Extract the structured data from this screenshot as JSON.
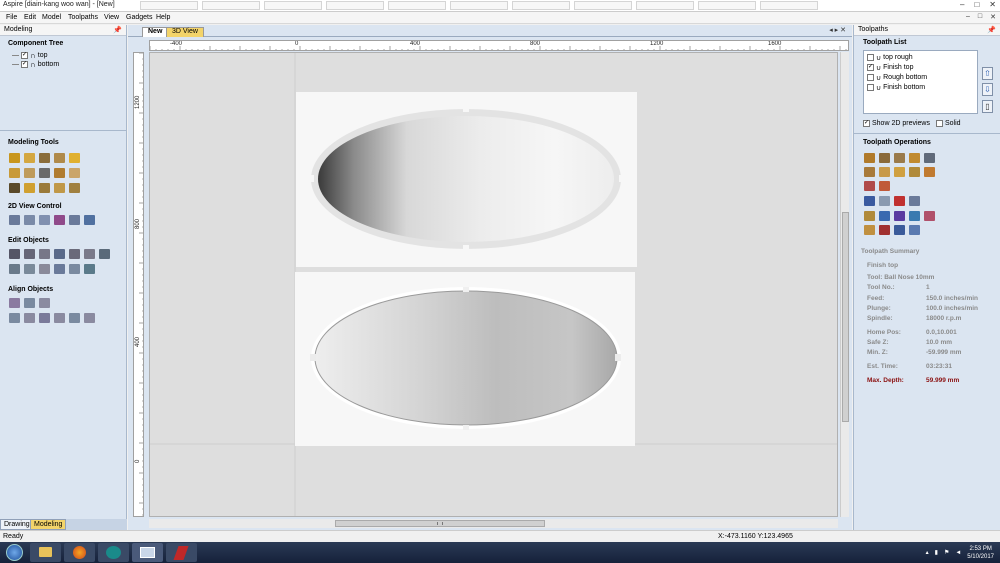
{
  "window": {
    "title": "Aspire [diain-kang woo wan] - [New]",
    "controls": [
      "–",
      "□",
      "✕"
    ]
  },
  "menu": {
    "items": [
      "File",
      "Edit",
      "Model",
      "Toolpaths",
      "View",
      "Gadgets",
      "Help"
    ],
    "mdi_controls": [
      "–",
      "□",
      "✕"
    ]
  },
  "left_panel": {
    "header": "Modeling",
    "pin": "📌",
    "component_tree_title": "Component Tree",
    "components": [
      {
        "label": "top",
        "checked": true
      },
      {
        "label": "bottom",
        "checked": true
      }
    ],
    "sections": {
      "modeling_tools": "Modeling Tools",
      "view_control": "2D View Control",
      "edit_objects": "Edit Objects",
      "align_objects": "Align Objects"
    },
    "bottom_tabs": [
      "Drawing",
      "Modeling"
    ]
  },
  "view_tabs": {
    "tabs": [
      "New",
      "3D View"
    ],
    "controls": "◂ ▸ ✕"
  },
  "rulers": {
    "horizontal": [
      "-400",
      "0",
      "400",
      "800",
      "1200",
      "1600"
    ],
    "vertical": [
      "1200",
      "800",
      "400",
      "0"
    ]
  },
  "right_panel": {
    "header": "Toolpaths",
    "pin": "📌",
    "list_title": "Toolpath List",
    "toolpaths": [
      {
        "label": "top rough",
        "checked": false
      },
      {
        "label": "Finish top",
        "checked": true
      },
      {
        "label": "Rough bottom",
        "checked": false
      },
      {
        "label": "Finish bottom",
        "checked": false
      }
    ],
    "show_2d_previews": {
      "label": "Show 2D previews",
      "checked": true
    },
    "solid": {
      "label": "Solid",
      "checked": false
    },
    "operations_title": "Toolpath Operations",
    "summary": {
      "title": "Toolpath Summary",
      "name": "Finish top",
      "tool": "Tool: Ball Nose 10mm",
      "rows": [
        {
          "label": "Tool No.:",
          "value": "1"
        },
        {
          "label": "Feed:",
          "value": "150.0 inches/min"
        },
        {
          "label": "Plunge:",
          "value": "100.0 inches/min"
        },
        {
          "label": "Spindle:",
          "value": "18000 r.p.m"
        },
        {
          "label": "Home Pos:",
          "value": "0.0,10.001"
        },
        {
          "label": "Safe Z:",
          "value": "10.0 mm"
        },
        {
          "label": "Min. Z:",
          "value": "-59.999 mm"
        },
        {
          "label": "Est. Time:",
          "value": "03:23:31"
        },
        {
          "label": "Max. Depth:",
          "value": "59.999 mm"
        }
      ],
      "max_depth_color": "#8b1010"
    }
  },
  "status": {
    "left": "Ready",
    "coords": "X:-473.1160 Y:123.4965"
  },
  "taskbar": {
    "time": "2:53 PM",
    "date": "5/10/2017"
  },
  "icons": {
    "toolpath_arrows": [
      "up-arrow-icon",
      "down-arrow-icon",
      "delete-icon"
    ]
  }
}
